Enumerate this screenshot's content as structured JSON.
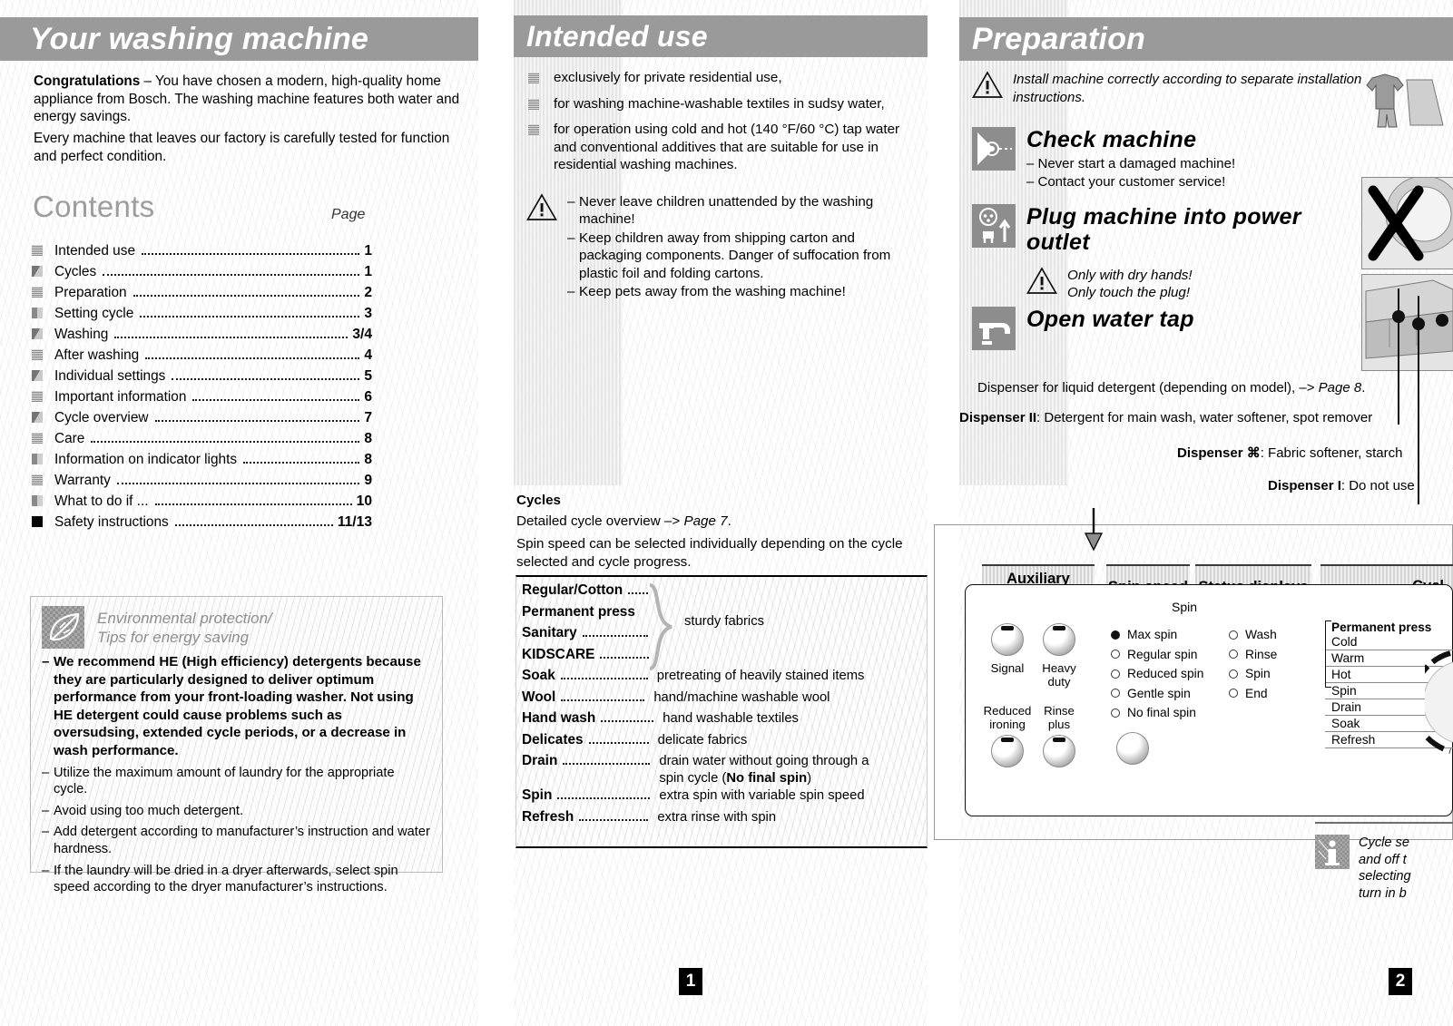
{
  "pages": {
    "left_number": "1",
    "right_number": "2"
  },
  "left": {
    "banner": "Your washing machine",
    "intro_bold": "Congratulations",
    "intro_1": " – You have chosen a modern, high-quality home appliance from Bosch. The washing machine features both water and energy savings.",
    "intro_2": "Every machine that leaves our factory is carefully tested for function and perfect condition.",
    "contents_title": "Contents",
    "contents_page_label": "Page",
    "toc": [
      {
        "label": "Intended use",
        "page": "1",
        "marker": "sq-a"
      },
      {
        "label": "Cycles",
        "page": "1",
        "marker": "sq-b"
      },
      {
        "label": "Preparation",
        "page": "2",
        "marker": "sq-a"
      },
      {
        "label": "Setting cycle",
        "page": "3",
        "marker": "sq-c"
      },
      {
        "label": "Washing",
        "page": "3/4",
        "marker": "sq-b"
      },
      {
        "label": "After washing",
        "page": "4",
        "marker": "sq-a"
      },
      {
        "label": "Individual settings",
        "page": "5",
        "marker": "sq-b"
      },
      {
        "label": "Important information",
        "page": "6",
        "marker": "sq-a"
      },
      {
        "label": "Cycle overview",
        "page": "7",
        "marker": "sq-b"
      },
      {
        "label": "Care",
        "page": "8",
        "marker": "sq-a"
      },
      {
        "label": "Information on indicator lights",
        "page": "8",
        "marker": "sq-c"
      },
      {
        "label": "Warranty",
        "page": "9",
        "marker": "sq-a"
      },
      {
        "label": "What to do if ...",
        "page": "10",
        "marker": "sq-c"
      },
      {
        "label": "Safety instructions",
        "page": "11/13",
        "marker": "sq-d"
      }
    ],
    "env": {
      "icon": "leaf-icon",
      "title_line1": "Environmental protection/",
      "title_line2": "Tips for energy saving",
      "items": [
        {
          "text": "We recommend HE (High efficiency) detergents because they are particularly designed to deliver optimum performance from your front-loading washer. Not using HE detergent could cause problems such as oversudsing, extended cycle periods, or a decrease in wash performance.",
          "strong": true
        },
        {
          "text": "Utilize the maximum amount of laundry for the appropriate cycle.",
          "strong": false
        },
        {
          "text": "Avoid using too much detergent.",
          "strong": false
        },
        {
          "text": "Add detergent according to manufacturer’s instruction and water hardness.",
          "strong": false
        },
        {
          "text": "If the laundry will be dried in a dryer afterwards, select spin speed according to the dryer manufacturer’s instructions.",
          "strong": false
        }
      ]
    }
  },
  "middle": {
    "banner": "Intended use",
    "bullets": [
      "exclusively for private residential use,",
      "for washing machine-washable textiles in sudsy water,",
      "for operation using cold and hot (140 °F/60 °C) tap water and conventional additives that are suitable for use in residential washing machines."
    ],
    "warning_icon": "warning-triangle-icon",
    "warnings": [
      "Never leave children unattended by the washing machine!",
      "Keep children away from shipping carton and packaging components. Danger of suffocation from plastic foil and folding cartons.",
      "Keep pets away from the washing machine!"
    ],
    "cycles_heading": "Cycles",
    "cycles_line1_a": "Detailed cycle overview –> ",
    "cycles_line1_b": "Page 7",
    "cycles_line1_c": ".",
    "cycles_line2": "Spin speed can be selected individually depending on the cycle selected and cycle progress.",
    "group_label": "sturdy fabrics",
    "cycle_rows": [
      {
        "name": "Regular/Cotton",
        "dots": 22,
        "desc": ""
      },
      {
        "name": "Permanent press",
        "dots": 0,
        "desc": ""
      },
      {
        "name": "Sanitary",
        "dots": 72,
        "desc": ""
      },
      {
        "name": "KIDSCARE",
        "dots": 54,
        "desc": ""
      },
      {
        "name": "Soak",
        "dots": 96,
        "desc": "pretreating of heavily stained items"
      },
      {
        "name": "Wool",
        "dots": 92,
        "desc": "hand/machine washable wool"
      },
      {
        "name": "Hand wash",
        "dots": 58,
        "desc": "hand washable textiles"
      },
      {
        "name": "Delicates",
        "dots": 66,
        "desc": "delicate fabrics"
      },
      {
        "name": "Drain",
        "dots": 96,
        "desc": "drain water without going through a spin cycle (No final spin)",
        "bold_tail": "No final spin"
      },
      {
        "name": "Spin",
        "dots": 102,
        "desc": "extra spin with variable spin speed"
      },
      {
        "name": "Refresh",
        "dots": 76,
        "desc": "extra rinse with spin"
      }
    ]
  },
  "right": {
    "banner": "Preparation",
    "install_warning": "Install machine correctly according to separate installation instructions.",
    "steps": [
      {
        "icon": "inspect-eye-icon",
        "heading": "Check machine",
        "lines": [
          "– Never start a damaged machine!",
          "– Contact your customer service!"
        ]
      },
      {
        "icon": "power-plug-icon",
        "heading": "Plug machine into power outlet",
        "lines": []
      },
      {
        "icon": "water-tap-icon",
        "heading": "Open water tap",
        "lines": []
      }
    ],
    "plug_warning_line1": "Only with dry hands!",
    "plug_warning_line2": "Only touch the plug!",
    "dispenser_liquid_a": "Dispenser for liquid detergent (depending on model), –> ",
    "dispenser_liquid_b": "Page 8",
    "dispenser_liquid_c": ".",
    "dispenser_II_label": "Dispenser II",
    "dispenser_II_text": ": Detergent for main wash, water softener, spot remover",
    "dispenser_flower_label": "Dispenser ⌘",
    "dispenser_flower_text": ": Fabric softener, starch",
    "dispenser_I_label": "Dispenser I",
    "dispenser_I_text": ": Do not use",
    "panel": {
      "tabs": [
        "Auxiliary functions",
        "Spin speed",
        "Status displays",
        "Cycl"
      ],
      "spin_caption": "Spin",
      "knobs": [
        {
          "label_line1": "Signal",
          "label_line2": ""
        },
        {
          "label_line1": "Heavy",
          "label_line2": "duty"
        },
        {
          "label_line1": "Reduced",
          "label_line2": "ironing"
        },
        {
          "label_line1": "Rinse",
          "label_line2": "plus"
        }
      ],
      "spin_options": [
        {
          "label": "Max spin",
          "selected": true
        },
        {
          "label": "Regular spin",
          "selected": false
        },
        {
          "label": "Reduced spin",
          "selected": false
        },
        {
          "label": "Gentle spin",
          "selected": false
        },
        {
          "label": "No final spin",
          "selected": false
        }
      ],
      "status_options": [
        {
          "label": "Wash",
          "selected": false
        },
        {
          "label": "Rinse",
          "selected": false
        },
        {
          "label": "Spin",
          "selected": false
        },
        {
          "label": "End",
          "selected": false
        }
      ],
      "cycle_selector": {
        "group_heading": "Permanent press",
        "items": [
          "Cold",
          "Warm",
          "Hot",
          "Spin",
          "Drain",
          "Soak",
          "Refresh"
        ]
      }
    },
    "info_icon": "information-icon",
    "info_lines": [
      "Cycle se",
      "and off t",
      "selecting",
      "turn in b"
    ]
  }
}
